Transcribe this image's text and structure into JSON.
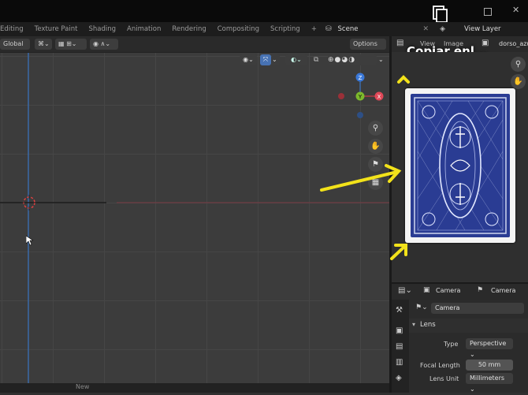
{
  "overlay": {
    "copy_label": "Copiar enl..."
  },
  "workspace_tabs": [
    "Editing",
    "Texture Paint",
    "Shading",
    "Animation",
    "Rendering",
    "Compositing",
    "Scripting",
    "+"
  ],
  "scene": {
    "label": "Scene"
  },
  "view_layer": {
    "label": "View Layer"
  },
  "viewport_header": {
    "orientation": "Global",
    "options_label": "Options"
  },
  "image_editor": {
    "view_label": "View",
    "image_label": "Image",
    "image_name": "dorso_azu"
  },
  "properties": {
    "breadcrumb_1": "Camera",
    "breadcrumb_2": "Camera",
    "data_name": "Camera",
    "section_lens": "Lens",
    "type_label": "Type",
    "type_value": "Perspective",
    "focal_label": "Focal Length",
    "focal_value": "50 mm",
    "lens_unit_label": "Lens Unit",
    "lens_unit_value": "Millimeters"
  },
  "bottom_bar": {
    "new_label": "New"
  },
  "colors": {
    "accent": "#4772b3",
    "annotation": "#f2e21a",
    "card_blue": "#2a3c93",
    "axis_red": "#9a3a44",
    "axis_blue": "#3a6aa8",
    "axis_green": "#6a9a2a"
  }
}
